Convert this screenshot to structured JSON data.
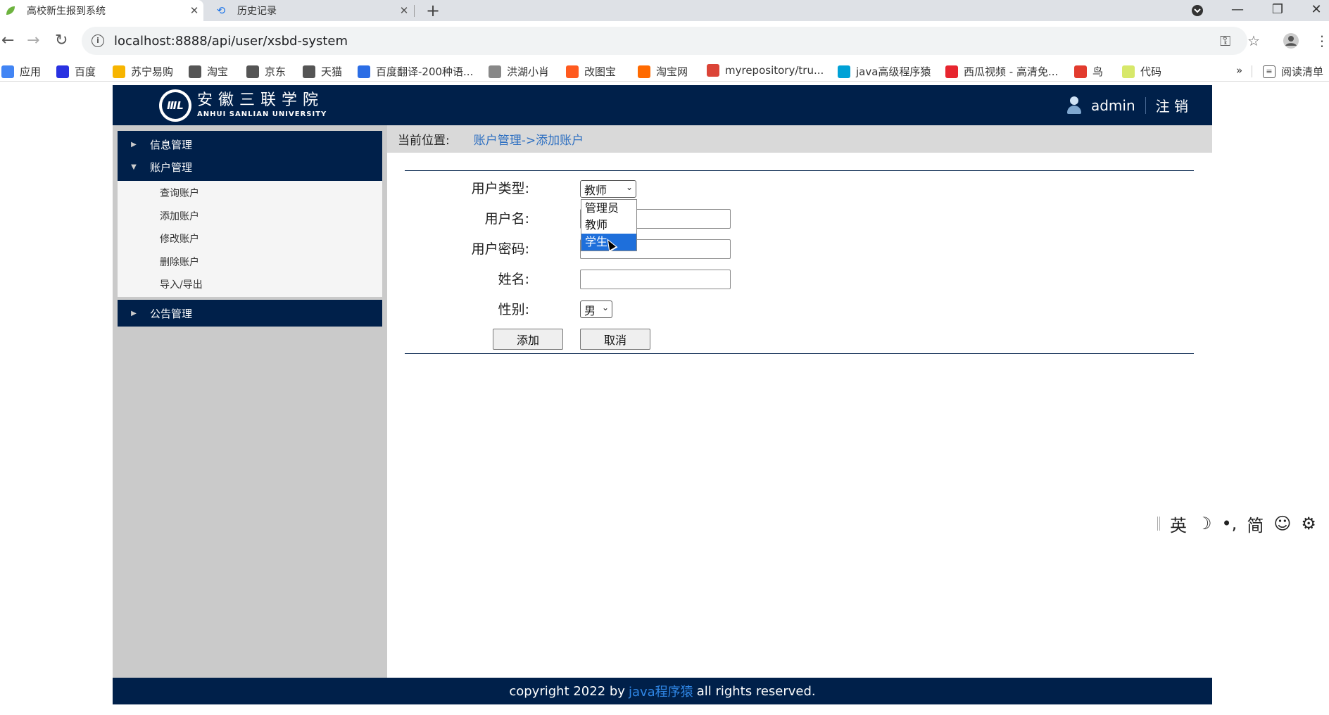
{
  "browser": {
    "tabs": [
      {
        "title": "高校新生报到系统",
        "active": true
      },
      {
        "title": "历史记录",
        "active": false
      }
    ],
    "url": "localhost:8888/api/user/xsbd-system",
    "bookmarks": [
      {
        "label": "应用",
        "icon": "apps-icon",
        "color": "#4285f4"
      },
      {
        "label": "百度",
        "icon": "baidu-icon",
        "color": "#2932e1"
      },
      {
        "label": "苏宁易购",
        "icon": "suning-icon",
        "color": "#f7b500"
      },
      {
        "label": "淘宝",
        "icon": "globe-icon",
        "color": "#555555"
      },
      {
        "label": "京东",
        "icon": "globe-icon",
        "color": "#555555"
      },
      {
        "label": "天猫",
        "icon": "globe-icon",
        "color": "#555555"
      },
      {
        "label": "百度翻译-200种语...",
        "icon": "translate-icon",
        "color": "#2b6de5"
      },
      {
        "label": "洪湖小肖",
        "icon": "bird-icon",
        "color": "#888888"
      },
      {
        "label": "改图宝",
        "icon": "gaitubao-icon",
        "color": "#ff5a1f"
      },
      {
        "label": "淘宝网",
        "icon": "taobao-icon",
        "color": "#ff6a00"
      },
      {
        "label": "myrepository/tru...",
        "icon": "chrome-icon",
        "color": "#db4437"
      },
      {
        "label": "java高级程序猿",
        "icon": "bilibili-icon",
        "color": "#00a1d6"
      },
      {
        "label": "西瓜视频 - 高清免...",
        "icon": "xigua-icon",
        "color": "#e7252f"
      },
      {
        "label": "鸟",
        "icon": "bird-red-icon",
        "color": "#e23b2e"
      },
      {
        "label": "代码",
        "icon": "code-icon",
        "color": "#d7e86a"
      }
    ],
    "more_label": "»",
    "reading_list": "阅读清单"
  },
  "header": {
    "logo_cn": "安徽三联学院",
    "logo_en": "ANHUI SANLIAN UNIVERSITY",
    "logo_badge": "ⅢL",
    "username": "admin",
    "logout": "注 销"
  },
  "sidebar": {
    "groups": [
      {
        "label": "信息管理",
        "expanded": false
      },
      {
        "label": "账户管理",
        "expanded": true
      },
      {
        "label": "公告管理",
        "expanded": false
      }
    ],
    "account_items": [
      "查询账户",
      "添加账户",
      "修改账户",
      "删除账户",
      "导入/导出"
    ]
  },
  "breadcrumb": {
    "prefix": "当前位置:",
    "path": "账户管理->添加账户"
  },
  "form": {
    "user_type_label": "用户类型:",
    "user_type_value": "教师",
    "user_type_options": [
      "管理员",
      "教师",
      "学生"
    ],
    "highlighted_option": "学生",
    "username_label": "用户名:",
    "password_label": "用户密码:",
    "name_label": "姓名:",
    "gender_label": "性别:",
    "gender_value": "男",
    "add_button": "添加",
    "cancel_button": "取消"
  },
  "footer": {
    "prefix": "copyright 2022 by",
    "brand": "java程序猿",
    "suffix": "all rights reserved."
  },
  "ime": [
    "英",
    "☽",
    "•,",
    "简",
    "☺",
    "⚙"
  ]
}
